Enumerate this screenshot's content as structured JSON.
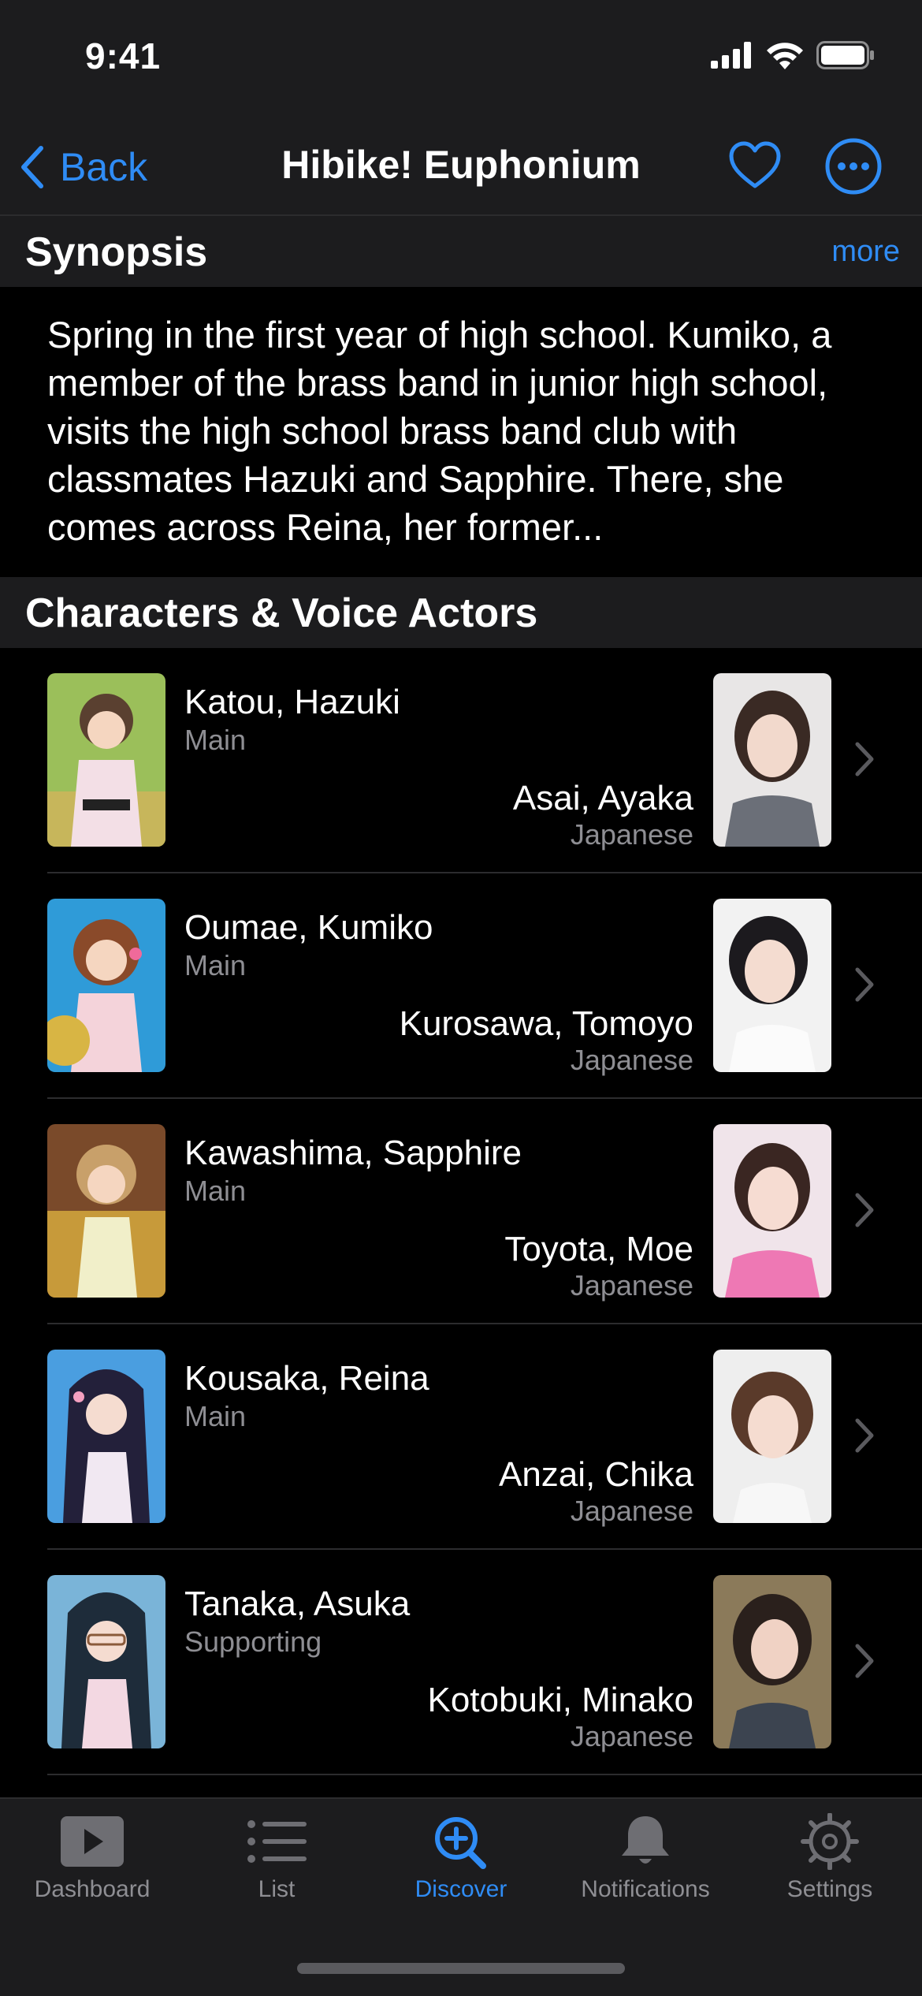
{
  "status_bar": {
    "time": "9:41"
  },
  "nav": {
    "back_label": "Back",
    "title": "Hibike! Euphonium"
  },
  "synopsis": {
    "header": "Synopsis",
    "more_label": "more",
    "text": "Spring in the first year of high school. Kumiko, a member of the brass band in junior high school, visits the high school brass band club with classmates Hazuki and Sapphire. There, she comes across Reina, her former..."
  },
  "characters": {
    "header": "Characters & Voice Actors",
    "items": [
      {
        "name": "Katou, Hazuki",
        "role": "Main",
        "va_name": "Asai, Ayaka",
        "va_language": "Japanese"
      },
      {
        "name": "Oumae, Kumiko",
        "role": "Main",
        "va_name": "Kurosawa, Tomoyo",
        "va_language": "Japanese"
      },
      {
        "name": "Kawashima, Sapphire",
        "role": "Main",
        "va_name": "Toyota, Moe",
        "va_language": "Japanese"
      },
      {
        "name": "Kousaka, Reina",
        "role": "Main",
        "va_name": "Anzai, Chika",
        "va_language": "Japanese"
      },
      {
        "name": "Tanaka, Asuka",
        "role": "Supporting",
        "va_name": "Kotobuki, Minako",
        "va_language": "Japanese"
      }
    ]
  },
  "tab_bar": {
    "active": "Discover",
    "tabs": [
      {
        "label": "Dashboard",
        "icon": "play-icon"
      },
      {
        "label": "List",
        "icon": "list-icon"
      },
      {
        "label": "Discover",
        "icon": "magnify-plus-icon"
      },
      {
        "label": "Notifications",
        "icon": "bell-icon"
      },
      {
        "label": "Settings",
        "icon": "gear-icon"
      }
    ]
  },
  "colors": {
    "accent": "#2f8cf5",
    "background": "#000000",
    "bar": "#1c1c1e",
    "secondary_text": "#8e8e93"
  }
}
